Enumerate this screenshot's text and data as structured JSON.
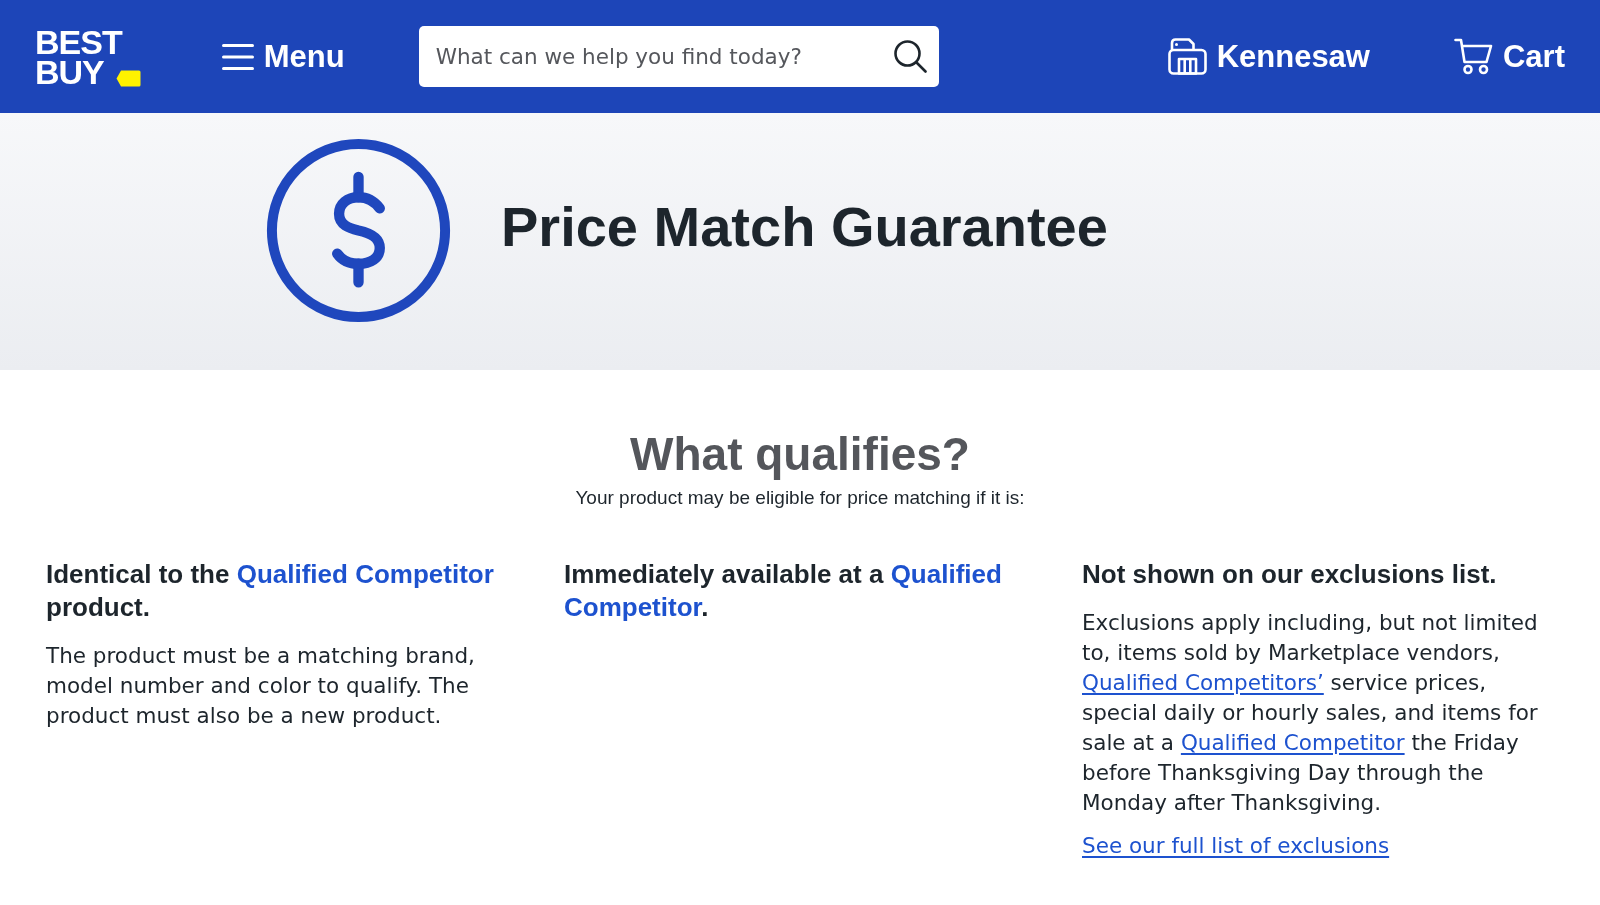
{
  "header": {
    "logo": {
      "text": "BEST BUY"
    },
    "menu": {
      "label": "Menu"
    },
    "search": {
      "placeholder": "What can we help you find today?"
    },
    "store": {
      "label": "Kennesaw"
    },
    "cart": {
      "label": "Cart"
    }
  },
  "hero": {
    "title": "Price Match Guarantee"
  },
  "qualifies": {
    "title": "What qualifies?",
    "subtitle": "Your product may be eligible for price matching if it is:",
    "columns": [
      {
        "heading": [
          {
            "kind": "text",
            "text": "Identical to the "
          },
          {
            "kind": "term",
            "text": "Qualified Competitor"
          },
          {
            "kind": "text",
            "text": " product."
          }
        ],
        "body": [
          {
            "kind": "text",
            "text": "The product must be a matching brand, model number and color to qualify. The product must also be a new product."
          }
        ]
      },
      {
        "heading": [
          {
            "kind": "text",
            "text": "Immediately available at a "
          },
          {
            "kind": "term",
            "text": "Qualified Competitor"
          },
          {
            "kind": "text",
            "text": "."
          }
        ]
      },
      {
        "heading": [
          {
            "kind": "text",
            "text": "Not shown on our exclusions list."
          }
        ],
        "body": [
          {
            "kind": "text",
            "text": "Exclusions apply including, but not limited to, items sold by Marketplace vendors, "
          },
          {
            "kind": "link",
            "text": "Qualified Competitors’"
          },
          {
            "kind": "text",
            "text": " service prices, special daily or hourly sales, and items for sale at a "
          },
          {
            "kind": "link",
            "text": "Qualified Competitor"
          },
          {
            "kind": "text",
            "text": " the Friday before Thanksgiving Day through the Monday after Thanksgiving."
          }
        ],
        "link": "See our full list of exclusions"
      }
    ]
  }
}
